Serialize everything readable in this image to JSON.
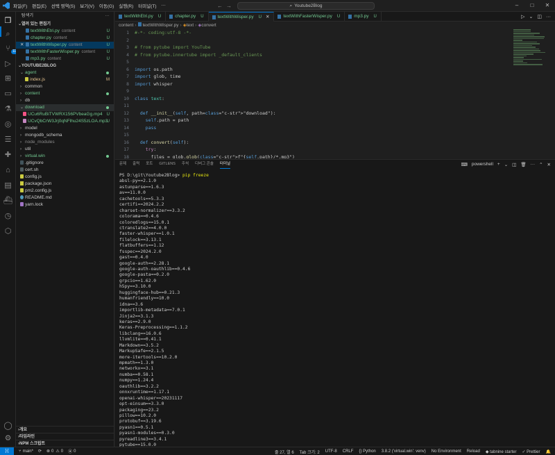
{
  "window": {
    "menus": [
      "파일(F)",
      "편집(E)",
      "선택 영역(S)",
      "보기(V)",
      "이동(G)",
      "실행(R)",
      "터미널(T)",
      "…"
    ],
    "search": "Youtube2Blog"
  },
  "sidebar": {
    "title": "탐색기",
    "open_editors_label": "열려 있는 편집기",
    "open_editors": [
      {
        "name": "textWithEtri.py",
        "desc": "content",
        "status": "U"
      },
      {
        "name": "chapter.py",
        "desc": "content",
        "status": "U"
      },
      {
        "name": "textWithWisper.py",
        "desc": "content",
        "status": "U"
      },
      {
        "name": "textWithFasterWisper.py",
        "desc": "content",
        "status": "U"
      },
      {
        "name": "mp3.py",
        "desc": "content",
        "status": "U"
      }
    ],
    "project_label": "YOUTUBE2BLOG",
    "tree": [
      {
        "name": "agent",
        "status": "dot"
      },
      {
        "name": "index.js",
        "status": "M"
      },
      {
        "name": "common",
        "status": ""
      },
      {
        "name": "content",
        "status": "dot"
      },
      {
        "name": "db",
        "status": ""
      },
      {
        "name": "download",
        "status": "dot"
      },
      {
        "name": "UCu6RuBiTVWRX156PVbeaGg.mp4",
        "status": "U"
      },
      {
        "name": "UCvQbCrW3Jrj0qNFlhu24S5zLOA.mp3",
        "status": "U"
      },
      {
        "name": "model",
        "status": ""
      },
      {
        "name": "mongodb_schema",
        "status": ""
      },
      {
        "name": "node_modules",
        "status": ""
      },
      {
        "name": "util",
        "status": ""
      },
      {
        "name": "virtual.win",
        "status": "dot"
      },
      {
        "name": ".gitignore",
        "status": ""
      },
      {
        "name": "cert.sh",
        "status": ""
      },
      {
        "name": "config.js",
        "status": ""
      },
      {
        "name": "package.json",
        "status": ""
      },
      {
        "name": "pm2.config.js",
        "status": ""
      },
      {
        "name": "README.md",
        "status": ""
      },
      {
        "name": "yarn.lock",
        "status": ""
      }
    ],
    "bottom": [
      "개요",
      "타임라인",
      "NPM 스크립트"
    ]
  },
  "tabs": [
    {
      "label": "textWithEtri.py",
      "status": "U"
    },
    {
      "label": "chapter.py",
      "status": "U"
    },
    {
      "label": "textWithWisper.py",
      "status": "U"
    },
    {
      "label": "textWithFasterWisper.py",
      "status": "U"
    },
    {
      "label": "mp3.py",
      "status": "U"
    }
  ],
  "breadcrumb": [
    "content",
    "textWithWisper.py",
    "text",
    "convert"
  ],
  "editor": {
    "line_numbers": [
      "1",
      "2",
      "3",
      "4",
      "5",
      "6",
      "7",
      "8",
      "9",
      "10",
      "11",
      "12",
      "13",
      "14",
      "15",
      "16",
      "17",
      "18",
      "19",
      "20",
      "21"
    ],
    "lines": [
      "#-*- coding:utf-8 -*-",
      "",
      "# from pytube import YouTube",
      "# from pytube.innertube import _default_clients",
      "",
      "import os.path",
      "import glob, time",
      "import whisper",
      "",
      "class text:",
      "",
      "  def __init__(self, path=\"download\"):",
      "    self.path = path",
      "    pass",
      "",
      "  def convert(self):",
      "    try:",
      "      files = glob.glob(f\"{self.path}/*.mp3\")",
      "      model = whisper.load_model(\"medium\", device=\"cuda\")",
      "      #  fp16=False",
      "      # model = whisper.load_model(\"medium\")"
    ]
  },
  "panel": {
    "tabs": [
      "문제",
      "출력",
      "포트",
      "GITLENS",
      "주석",
      "디버그 콘솔",
      "터미널"
    ],
    "shell": "powershell",
    "prompt": "PS D:\\git\\Youtube2Blog>",
    "command": "pip freeze",
    "output": [
      "absl-py==2.1.0",
      "astunparse==1.6.3",
      "av==11.0.0",
      "cachetools==5.3.3",
      "certifi==2024.2.2",
      "charset-normalizer==3.3.2",
      "colorama==0.4.6",
      "coloredlogs==15.0.1",
      "ctranslate2==4.0.0",
      "faster-whisper==1.0.1",
      "filelock==3.13.1",
      "flatbuffers==1.12",
      "fsspec==2024.2.0",
      "gast==0.4.0",
      "google-auth==2.28.1",
      "google-auth-oauthlib==0.4.6",
      "google-pasta==0.2.0",
      "grpcio==1.62.0",
      "h5py==3.10.0",
      "huggingface-hub==0.21.3",
      "humanfriendly==10.0",
      "idna==3.6",
      "importlib-metadata==7.0.1",
      "Jinja2==3.1.3",
      "keras==2.9.0",
      "Keras-Preprocessing==1.1.2",
      "libclang==16.0.6",
      "llvmlite==0.41.1",
      "Markdown==3.5.2",
      "MarkupSafe==2.1.5",
      "more-itertools==10.2.0",
      "mpmath==1.3.0",
      "networkx==3.1",
      "numba==0.58.1",
      "numpy==1.24.4",
      "oauthlib==3.2.2",
      "onnxruntime==1.17.1",
      "openai-whisper==20231117",
      "opt-einsum==3.3.0",
      "packaging==23.2",
      "pillow==10.2.0",
      "protobuf==3.19.6",
      "pyasn1==0.5.1",
      "pyasn1-modules==0.3.0",
      "pyreadline3==3.4.1",
      "pytube==15.0.0",
      "PyYAML==6.0.1",
      "regex==2023.12.25",
      "requests==2.31.0"
    ]
  },
  "status": {
    "branch": "main*",
    "sync": "⟳",
    "errors": "0",
    "warnings": "0",
    "ports": "0",
    "position": "줄 27, 열 6",
    "indent": "Tab 크기: 2",
    "encoding": "UTF-8",
    "eol": "CRLF",
    "language": "Python",
    "interpreter": "3.8.2 ('virtual.win': venv)",
    "env": "No Environment",
    "reload": "Reload",
    "tabnine": "tabnine starter",
    "prettier": "Prettier"
  }
}
